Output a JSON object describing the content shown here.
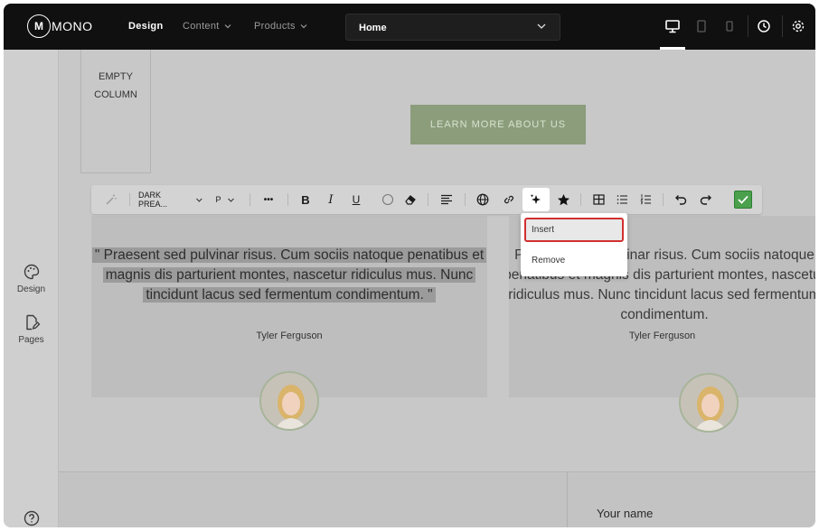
{
  "app": {
    "logo_mark": "M",
    "logo_text": "MONO"
  },
  "topbar": {
    "nav": [
      {
        "label": "Design",
        "active": true
      },
      {
        "label": "Content",
        "dropdown": true
      },
      {
        "label": "Products",
        "dropdown": true
      }
    ],
    "page_select": {
      "value": "Home"
    },
    "icons": [
      "desktop-icon",
      "tablet-icon",
      "mobile-icon",
      "history-icon",
      "settings-icon"
    ]
  },
  "sidebar": {
    "items": [
      {
        "label": "Design",
        "icon": "palette-icon"
      },
      {
        "label": "Pages",
        "icon": "pages-icon"
      }
    ],
    "help_icon": "help-icon"
  },
  "canvas": {
    "empty_column_label": "EMPTY COLUMN",
    "cta_label": "LEARN MORE ABOUT US",
    "testimonials": [
      {
        "quote": "\" Praesent sed pulvinar risus. Cum sociis natoque penatibus et magnis dis parturient montes, nascetur ridiculus mus. Nunc tincidunt lacus sed fermentum condimentum. \"",
        "author": "Tyler Ferguson"
      },
      {
        "quote": "Praesent sed pulvinar risus. Cum sociis natoque penatibus et magnis dis parturient montes, nascetur ridiculus mus. Nunc tincidunt lacus sed fermentum condimentum.",
        "author": "Tyler Ferguson"
      }
    ],
    "form_label": "Your name"
  },
  "toolbar": {
    "color_select": "DARK PREA...",
    "block_select": "P",
    "more_label": "•••",
    "bold_label": "B",
    "italic_label": "I",
    "underline_label": "U"
  },
  "ai_dropdown": {
    "items": [
      "Insert",
      "Remove"
    ],
    "highlighted": "Insert"
  },
  "colors": {
    "topbar_bg": "#101010",
    "cta_bg": "#8b9d7b",
    "accept_green": "#4aa04c",
    "highlight_red": "#d32f2f"
  }
}
